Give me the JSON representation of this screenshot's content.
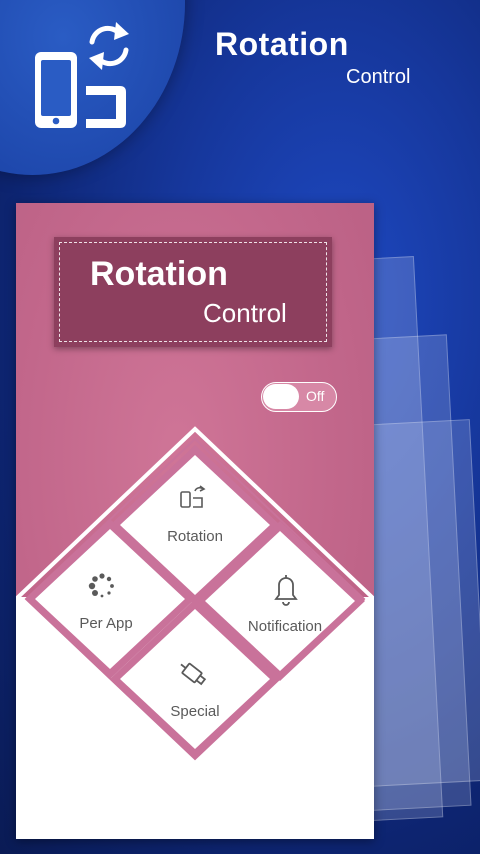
{
  "header": {
    "title": "Rotation",
    "subtitle": "Control",
    "logo_icon": "phone-rotate-icon"
  },
  "card": {
    "badge_title": "Rotation",
    "badge_subtitle": "Control",
    "toggle": {
      "state": "Off",
      "label": "Off"
    },
    "tiles": [
      {
        "label": "Rotation",
        "icon": "phone-rotate-icon"
      },
      {
        "label": "Per App",
        "icon": "dots-spinner-icon"
      },
      {
        "label": "Notification",
        "icon": "bell-icon"
      },
      {
        "label": "Special",
        "icon": "usb-plug-icon"
      }
    ]
  },
  "colors": {
    "background": "#16379c",
    "card_pink": "#c2678b",
    "badge": "#8d3f5e",
    "tile_border": "#c9729a",
    "icon": "#5a5a5a"
  }
}
